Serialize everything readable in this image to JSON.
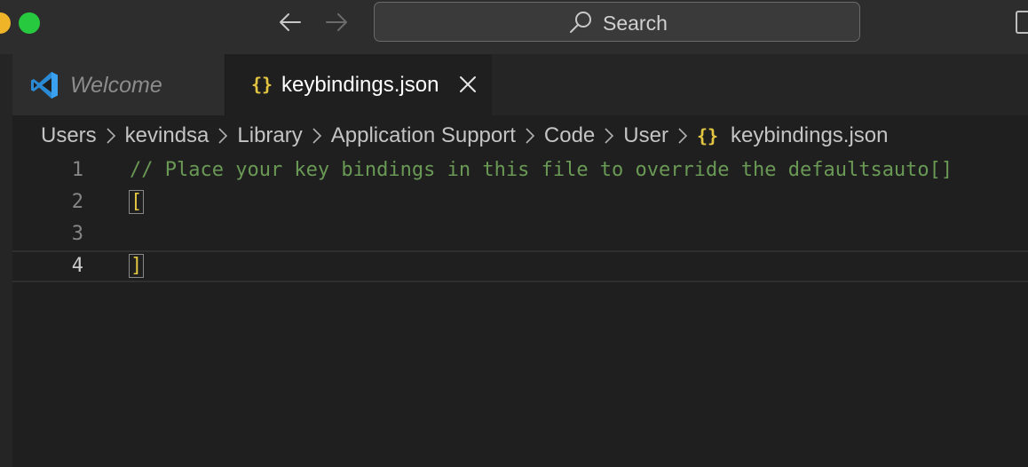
{
  "titlebar": {
    "search_placeholder": "Search",
    "back_icon": "arrow-left-icon",
    "forward_icon": "arrow-right-icon"
  },
  "tabs": [
    {
      "label": "Welcome",
      "icon": "vscode-icon",
      "active": false
    },
    {
      "label": "keybindings.json",
      "icon": "json-braces-icon",
      "icon_text": "{}",
      "active": true
    }
  ],
  "breadcrumb": {
    "items": [
      "Users",
      "kevindsa",
      "Library",
      "Application Support",
      "Code",
      "User"
    ],
    "file_icon_text": "{}",
    "file": "keybindings.json"
  },
  "editor": {
    "lines": [
      {
        "number": "1",
        "text": "// Place your key bindings in this file to override the defaultsauto[]"
      },
      {
        "number": "2",
        "text": "["
      },
      {
        "number": "3",
        "text": ""
      },
      {
        "number": "4",
        "text": "]"
      }
    ]
  },
  "colors": {
    "comment": "#6a9955",
    "json_icon": "#e2c541",
    "bracket": "#e2c541",
    "traffic_green": "#27c93f",
    "traffic_yellow": "#f0b429"
  }
}
